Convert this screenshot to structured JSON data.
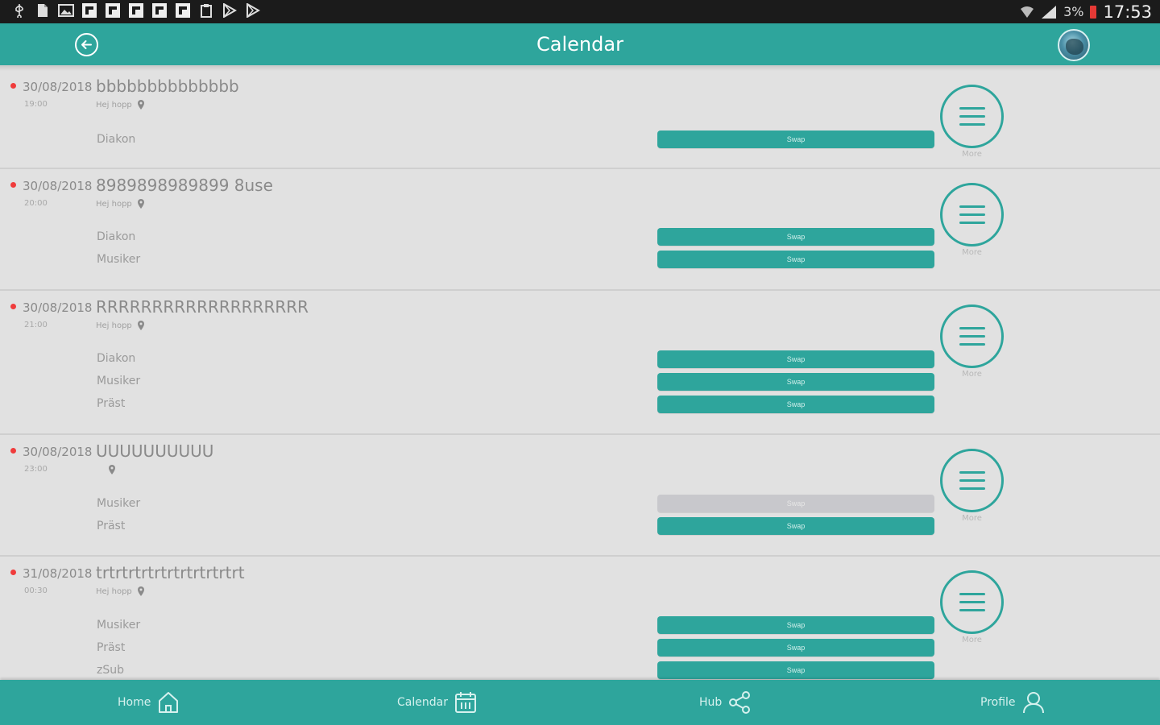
{
  "status_bar": {
    "battery_pct": "3%",
    "time": "17:53"
  },
  "header": {
    "title": "Calendar"
  },
  "events": [
    {
      "date": "30/08/2018",
      "time": "19:00",
      "title": "bbbbbbbbbbbbbb",
      "location": "Hej hopp",
      "roles": [
        {
          "label": "Diakon",
          "swap": "Swap",
          "enabled": true
        }
      ],
      "more_label": "More"
    },
    {
      "date": "30/08/2018",
      "time": "20:00",
      "title": "8989898989899 8use",
      "location": "Hej hopp",
      "roles": [
        {
          "label": "Diakon",
          "swap": "Swap",
          "enabled": true
        },
        {
          "label": "Musiker",
          "swap": "Swap",
          "enabled": true
        }
      ],
      "more_label": "More"
    },
    {
      "date": "30/08/2018",
      "time": "21:00",
      "title": "RRRRRRRRRRRRRRRRRRR",
      "location": "Hej hopp",
      "roles": [
        {
          "label": "Diakon",
          "swap": "Swap",
          "enabled": true
        },
        {
          "label": "Musiker",
          "swap": "Swap",
          "enabled": true
        },
        {
          "label": "Präst",
          "swap": "Swap",
          "enabled": true
        }
      ],
      "more_label": "More"
    },
    {
      "date": "30/08/2018",
      "time": "23:00",
      "title": "UUUUUUUUUU",
      "location": "",
      "roles": [
        {
          "label": "Musiker",
          "swap": "Swap",
          "enabled": false
        },
        {
          "label": "Präst",
          "swap": "Swap",
          "enabled": true
        }
      ],
      "more_label": "More"
    },
    {
      "date": "31/08/2018",
      "time": "00:30",
      "title": "trtrtrtrtrtrtrtrtrtrtrt",
      "location": "Hej hopp",
      "roles": [
        {
          "label": "Musiker",
          "swap": "Swap",
          "enabled": true
        },
        {
          "label": "Präst",
          "swap": "Swap",
          "enabled": true
        },
        {
          "label": "zSub",
          "swap": "Swap",
          "enabled": true
        }
      ],
      "more_label": "More"
    }
  ],
  "bottom_nav": {
    "home": "Home",
    "calendar": "Calendar",
    "hub": "Hub",
    "profile": "Profile"
  },
  "colors": {
    "accent": "#2ea59c",
    "background": "#e1e1e1",
    "status_bar": "#1b1b1b",
    "disabled": "#c8c8cc",
    "dot": "#f03c3c"
  }
}
